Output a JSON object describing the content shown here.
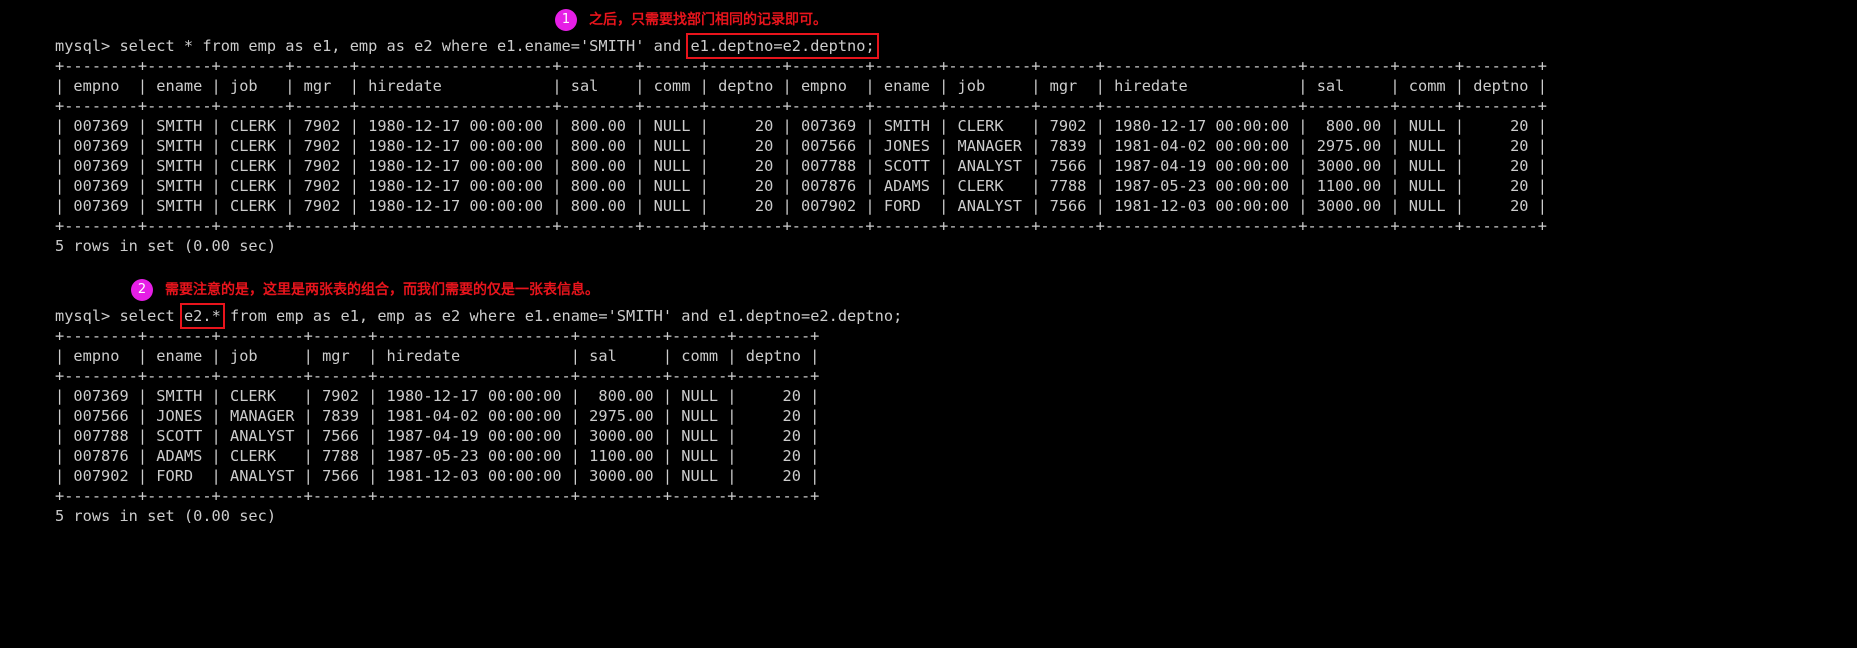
{
  "colors": {
    "annotation_text": "#e8141c",
    "annotation_badge": "#e61ee6",
    "highlight_box": "#e8141c",
    "terminal_text": "#cccccc",
    "terminal_bg": "#000000"
  },
  "annotation1": {
    "number": "1",
    "text": "之后，只需要找部门相同的记录即可。"
  },
  "annotation2": {
    "number": "2",
    "text": "需要注意的是，这里是两张表的组合，而我们需要的仅是一张表信息。"
  },
  "query1": {
    "before": "mysql> select * from emp as e1, emp as e2 where e1.ename='SMITH' and ",
    "highlight": "e1.deptno=e2.deptno;",
    "after": ""
  },
  "query2": {
    "before": "mysql> select ",
    "highlight": "e2.*",
    "after": " from emp as e1, emp as e2 where e1.ename='SMITH' and e1.deptno=e2.deptno;"
  },
  "table1": {
    "headers": [
      "empno",
      "ename",
      "job",
      "mgr",
      "hiredate",
      "sal",
      "comm",
      "deptno",
      "empno",
      "ename",
      "job",
      "mgr",
      "hiredate",
      "sal",
      "comm",
      "deptno"
    ],
    "rows": [
      [
        "007369",
        "SMITH",
        "CLERK",
        "7902",
        "1980-12-17 00:00:00",
        "800.00",
        "NULL",
        "20",
        "007369",
        "SMITH",
        "CLERK",
        "7902",
        "1980-12-17 00:00:00",
        "800.00",
        "NULL",
        "20"
      ],
      [
        "007369",
        "SMITH",
        "CLERK",
        "7902",
        "1980-12-17 00:00:00",
        "800.00",
        "NULL",
        "20",
        "007566",
        "JONES",
        "MANAGER",
        "7839",
        "1981-04-02 00:00:00",
        "2975.00",
        "NULL",
        "20"
      ],
      [
        "007369",
        "SMITH",
        "CLERK",
        "7902",
        "1980-12-17 00:00:00",
        "800.00",
        "NULL",
        "20",
        "007788",
        "SCOTT",
        "ANALYST",
        "7566",
        "1987-04-19 00:00:00",
        "3000.00",
        "NULL",
        "20"
      ],
      [
        "007369",
        "SMITH",
        "CLERK",
        "7902",
        "1980-12-17 00:00:00",
        "800.00",
        "NULL",
        "20",
        "007876",
        "ADAMS",
        "CLERK",
        "7788",
        "1987-05-23 00:00:00",
        "1100.00",
        "NULL",
        "20"
      ],
      [
        "007369",
        "SMITH",
        "CLERK",
        "7902",
        "1980-12-17 00:00:00",
        "800.00",
        "NULL",
        "20",
        "007902",
        "FORD",
        "ANALYST",
        "7566",
        "1981-12-03 00:00:00",
        "3000.00",
        "NULL",
        "20"
      ]
    ],
    "footer": "5 rows in set (0.00 sec)"
  },
  "table2": {
    "headers": [
      "empno",
      "ename",
      "job",
      "mgr",
      "hiredate",
      "sal",
      "comm",
      "deptno"
    ],
    "rows": [
      [
        "007369",
        "SMITH",
        "CLERK",
        "7902",
        "1980-12-17 00:00:00",
        "800.00",
        "NULL",
        "20"
      ],
      [
        "007566",
        "JONES",
        "MANAGER",
        "7839",
        "1981-04-02 00:00:00",
        "2975.00",
        "NULL",
        "20"
      ],
      [
        "007788",
        "SCOTT",
        "ANALYST",
        "7566",
        "1987-04-19 00:00:00",
        "3000.00",
        "NULL",
        "20"
      ],
      [
        "007876",
        "ADAMS",
        "CLERK",
        "7788",
        "1987-05-23 00:00:00",
        "1100.00",
        "NULL",
        "20"
      ],
      [
        "007902",
        "FORD",
        "ANALYST",
        "7566",
        "1981-12-03 00:00:00",
        "3000.00",
        "NULL",
        "20"
      ]
    ],
    "footer": "5 rows in set (0.00 sec)"
  }
}
